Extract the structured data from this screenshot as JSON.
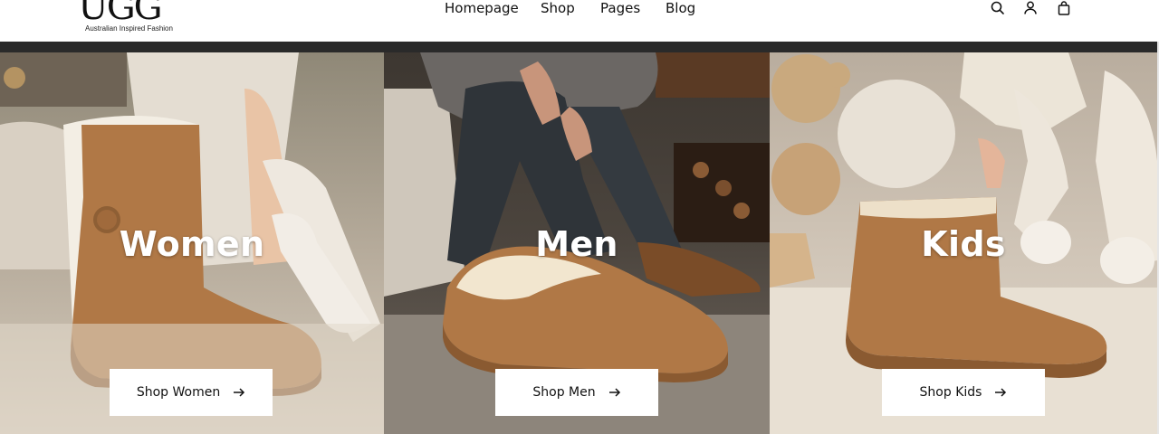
{
  "brand": {
    "logo_text": "UGG",
    "tagline": "Australian Inspired Fashion"
  },
  "nav": {
    "items": [
      {
        "label": "Homepage"
      },
      {
        "label": "Shop"
      },
      {
        "label": "Pages"
      },
      {
        "label": "Blog"
      }
    ]
  },
  "header_icons": [
    "search-icon",
    "user-icon",
    "shopping-bag-icon"
  ],
  "categories": [
    {
      "title": "Women",
      "button_label": "Shop Women",
      "button_icon": "arrow-right-icon"
    },
    {
      "title": "Men",
      "button_label": "Shop Men",
      "button_icon": "arrow-right-icon"
    },
    {
      "title": "Kids",
      "button_label": "Shop Kids",
      "button_icon": "arrow-right-icon"
    }
  ],
  "colors": {
    "header_bg": "#ffffff",
    "header_rule": "#2a2a2a",
    "button_bg": "#ffffff",
    "title_text": "#ffffff",
    "suede": "#b07846"
  }
}
